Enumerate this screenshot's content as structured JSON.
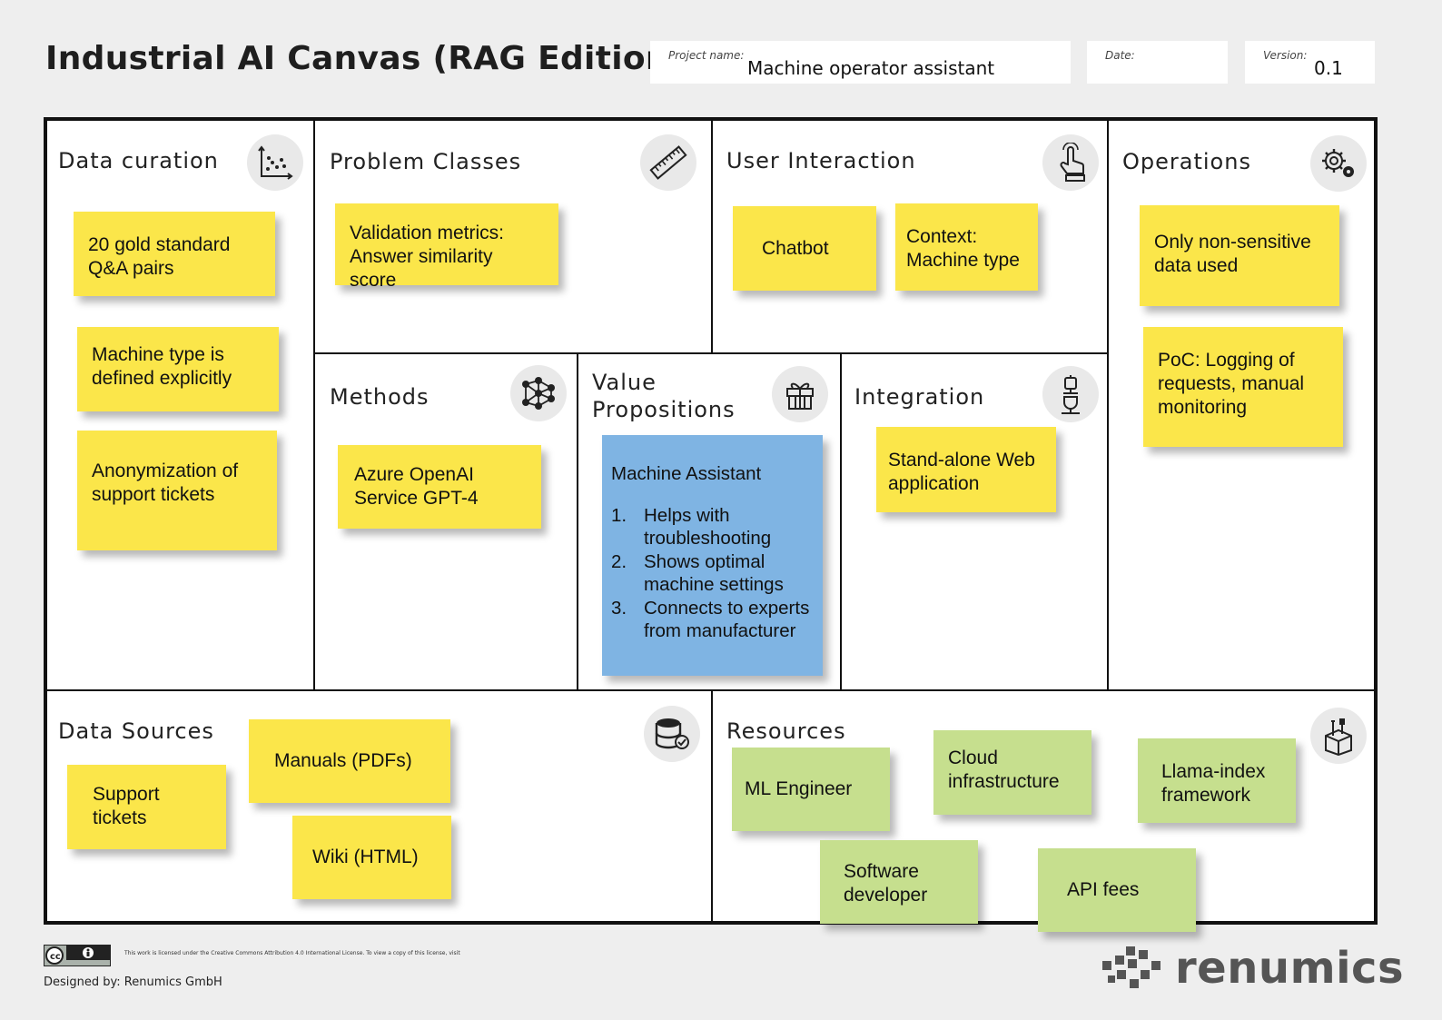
{
  "header": {
    "title": "Industrial AI Canvas (RAG Edition)",
    "project_label": "Project name:",
    "project_value": "Machine operator assistant",
    "date_label": "Date:",
    "date_value": "",
    "version_label": "Version:",
    "version_value": "0.1"
  },
  "sections": {
    "data_curation": {
      "title": "Data curation",
      "icon": "scatter-plot-icon",
      "notes": [
        "20 gold standard Q&A pairs",
        "Machine type is defined explicitly",
        "Anonymization of support tickets"
      ]
    },
    "problem_classes": {
      "title": "Problem Classes",
      "icon": "ruler-icon",
      "notes": [
        "Validation metrics: Answer similarity score"
      ]
    },
    "user_interaction": {
      "title": "User Interaction",
      "icon": "touch-hand-icon",
      "notes": [
        "Chatbot",
        "Context: Machine type"
      ]
    },
    "operations": {
      "title": "Operations",
      "icon": "gears-icon",
      "notes": [
        "Only non-sensitive data used",
        "PoC: Logging of requests, manual monitoring"
      ]
    },
    "methods": {
      "title": "Methods",
      "icon": "neural-network-icon",
      "notes": [
        "Azure OpenAI Service GPT-4"
      ]
    },
    "value_propositions": {
      "title": "Value Propositions",
      "icon": "gift-icon",
      "note_heading": "Machine Assistant",
      "items": [
        {
          "num": "1.",
          "text": "Helps with troubleshooting"
        },
        {
          "num": "2.",
          "text": "Shows optimal machine settings"
        },
        {
          "num": "3.",
          "text": "Connects to experts from manufacturer"
        }
      ]
    },
    "integration": {
      "title": "Integration",
      "icon": "plug-icon",
      "notes": [
        "Stand-alone Web application"
      ]
    },
    "data_sources": {
      "title": "Data Sources",
      "icon": "database-check-icon",
      "notes": [
        "Support tickets",
        "Manuals (PDFs)",
        "Wiki (HTML)"
      ]
    },
    "resources": {
      "title": "Resources",
      "icon": "toolbox-icon",
      "notes": [
        "ML Engineer",
        "Cloud infrastructure",
        "Llama-index framework",
        "Software developer",
        "API fees"
      ]
    }
  },
  "footer": {
    "license_text": "This work is licensed under the Creative Commons Attribution 4.0 International License. To view a copy of this license, visit",
    "designed_by": "Designed  by: Renumics  GmbH",
    "brand": "renumics",
    "cc_badge": "cc-by-badge-icon"
  },
  "colors": {
    "yellow_note": "#fbe64a",
    "green_note": "#c6df8e",
    "blue_note": "#7fb4e3",
    "frame": "#111111"
  }
}
